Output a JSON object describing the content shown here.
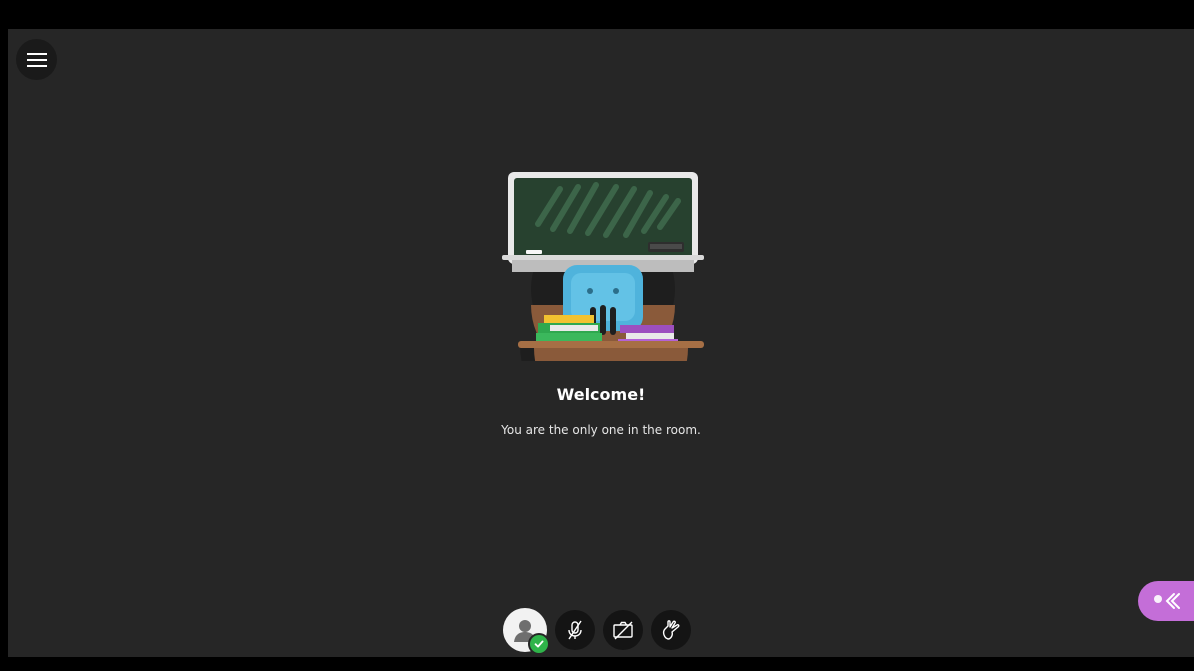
{
  "welcome": {
    "title": "Welcome!",
    "subtitle": "You are the only one in the room."
  },
  "icons": {
    "menu": "hamburger-icon",
    "avatar": "user-avatar-icon",
    "status": "checkmark-icon",
    "microphone": "microphone-off-icon",
    "camera": "camera-off-icon",
    "hand": "raise-hand-icon",
    "panel": "double-chevron-left-icon"
  },
  "colors": {
    "background": "#262626",
    "status_green": "#2fb44a",
    "panel_accent": "#c46ed8"
  }
}
